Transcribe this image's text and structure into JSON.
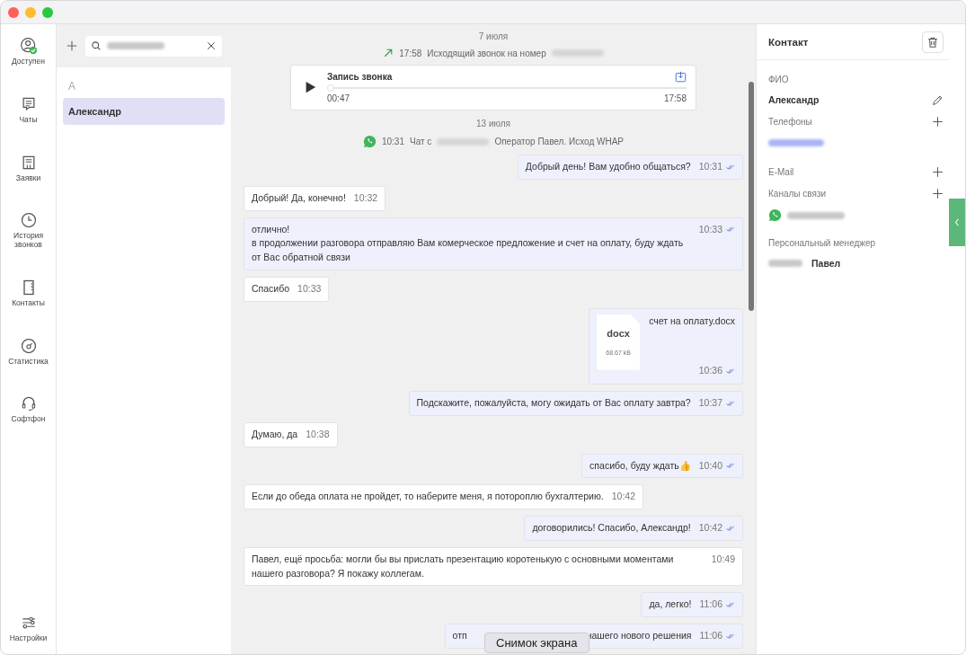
{
  "nav": [
    {
      "label": "Доступен",
      "selected": false
    },
    {
      "label": "Чаты",
      "selected": false
    },
    {
      "label": "Заявки",
      "selected": false
    },
    {
      "label": "История звонков",
      "selected": false
    },
    {
      "label": "Контакты",
      "selected": false
    },
    {
      "label": "Статистика",
      "selected": false
    },
    {
      "label": "Софтфон",
      "selected": false
    }
  ],
  "settings": {
    "label": "Настройки"
  },
  "contacts": {
    "letter": "А",
    "items": [
      {
        "name": "Александр",
        "selected": true
      }
    ]
  },
  "chat": {
    "items": [
      {
        "kind": "date",
        "text": "7 июля"
      },
      {
        "kind": "call",
        "time": "17:58",
        "text": "Исходящий звонок на номер"
      },
      {
        "kind": "recording",
        "title": "Запись звонка",
        "elapsed": "00:47",
        "end": "17:58",
        "level": 0
      },
      {
        "kind": "date",
        "text": "13 июля"
      },
      {
        "kind": "session",
        "time": "10:31",
        "text": "Чат с",
        "after": "Оператор Павел. Исход WHAP"
      },
      {
        "kind": "out",
        "text": "Добрый день! Вам удобно общаться?",
        "time": "10:31"
      },
      {
        "kind": "in",
        "text": "Добрый! Да, конечно!",
        "time": "10:32"
      },
      {
        "kind": "out",
        "text": "отлично!\nв продолжении разговора отправляю Вам комерческое предложение и счет на оплату, буду ждать от Вас обратной связи",
        "time": "10:33"
      },
      {
        "kind": "in",
        "text": "Спасибо",
        "time": "10:33"
      },
      {
        "kind": "file",
        "ext": "docx",
        "size": "68.67 kB",
        "text": "счет на оплату.docx",
        "time": "10:36"
      },
      {
        "kind": "out",
        "text": "Подскажите, пожалуйста, могу ожидать от Вас оплату завтра?",
        "time": "10:37"
      },
      {
        "kind": "in",
        "text": "Думаю, да",
        "time": "10:38"
      },
      {
        "kind": "out",
        "text": "спасибо, буду ждать👍",
        "time": "10:40"
      },
      {
        "kind": "in",
        "text": "Если до обеда оплата не пройдет, то наберите меня, я потороплю бухгалтерию.",
        "time": "10:42"
      },
      {
        "kind": "out",
        "text": "договорились! Спасибо, Александр!",
        "time": "10:42"
      },
      {
        "kind": "in",
        "text": "Павел, ещё просьба: могли бы вы прислать презентацию коротенькую с основными моментами нашего разговора? Я покажу коллегам.",
        "time": "10:49"
      },
      {
        "kind": "out",
        "text": "да, легко!",
        "time": "11:06"
      },
      {
        "kind": "covered",
        "start": "отп",
        "end": "нашего нового решения",
        "time": "11:06"
      }
    ]
  },
  "tooltip": "Снимок экрана",
  "contact": {
    "title": "Контакт",
    "name_label": "ФИО",
    "name": "Александр",
    "phones_label": "Телефоны",
    "email_label": "E-Mail",
    "channels_label": "Каналы связи",
    "manager_label": "Персональный менеджер",
    "manager_name": "Павел"
  }
}
